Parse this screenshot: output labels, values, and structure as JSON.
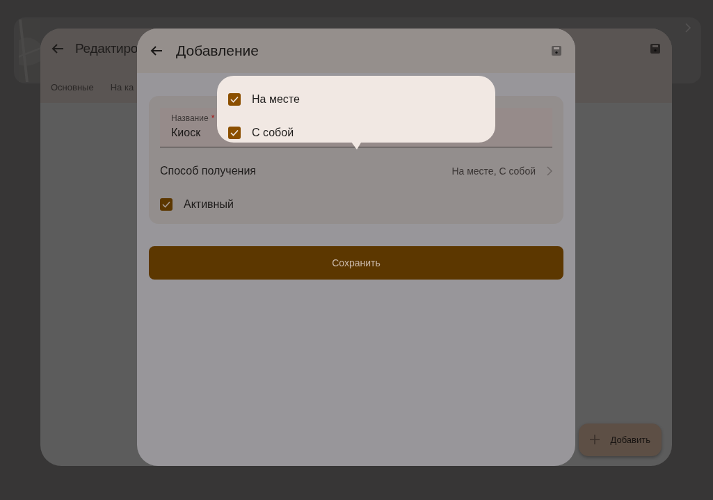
{
  "edit_dialog": {
    "title": "Редактиро",
    "tabs": [
      {
        "label": "Основные"
      },
      {
        "label": "На ка"
      }
    ],
    "add_button": "Добавить"
  },
  "add_dialog": {
    "title": "Добавление",
    "name_label": "Название",
    "required_mark": "*",
    "name_value": "Киоск",
    "method_label": "Способ получения",
    "method_value": "На месте, С собой",
    "active": {
      "label": "Активный",
      "checked": true
    },
    "save_button": "Сохранить"
  },
  "popover": {
    "options": [
      {
        "label": "На месте",
        "checked": true
      },
      {
        "label": "С собой",
        "checked": true
      }
    ]
  }
}
